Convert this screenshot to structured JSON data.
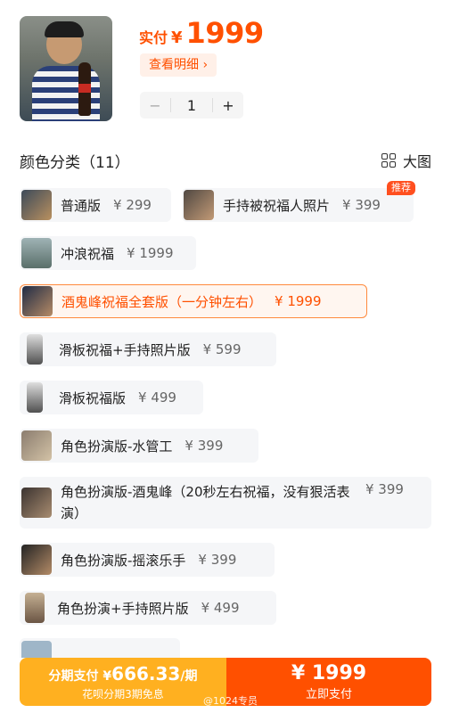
{
  "header": {
    "price_label": "实付",
    "currency": "¥",
    "price": "1999",
    "detail_button": "查看明细 ›",
    "quantity": "1",
    "minus": "−",
    "plus": "+"
  },
  "section": {
    "title": "颜色分类（11）",
    "big_view": "大图"
  },
  "options": [
    {
      "name": "普通版",
      "price": "¥ 299"
    },
    {
      "name": "手持被祝福人照片",
      "price": "¥ 399",
      "badge": "推荐"
    },
    {
      "name": "冲浪祝福",
      "price": "¥ 1999"
    },
    {
      "name": "酒鬼峰祝福全套版（一分钟左右）",
      "price": "¥ 1999",
      "selected": true
    },
    {
      "name": "滑板祝福+手持照片版",
      "price": "¥ 599"
    },
    {
      "name": "滑板祝福版",
      "price": "¥ 499"
    },
    {
      "name": "角色扮演版-水管工",
      "price": "¥ 399"
    },
    {
      "name": "角色扮演版-酒鬼峰（20秒左右祝福，没有狠活表演）",
      "price": "¥ 399"
    },
    {
      "name": "角色扮演版-摇滚乐手",
      "price": "¥ 399"
    },
    {
      "name": "角色扮演+手持照片版",
      "price": "¥ 499"
    }
  ],
  "bottom": {
    "installment_line1_prefix": "分期支付 ¥",
    "installment_amount": "666.33",
    "installment_suffix": "/期",
    "installment_line2": "花呗分期3期免息",
    "pay_amount": "¥ 1999",
    "pay_label": "立即支付",
    "watermark": "@1024专员"
  },
  "colors": {
    "accent": "#ff5000",
    "installment": "#ffb020"
  }
}
